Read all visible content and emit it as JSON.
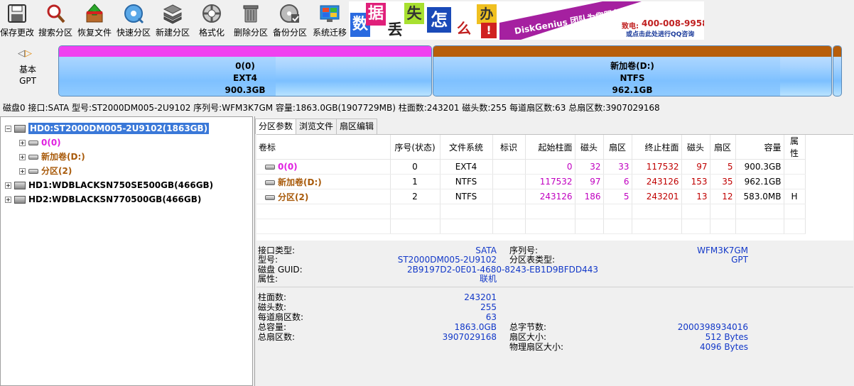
{
  "toolbar": {
    "buttons": [
      {
        "label": "保存更改",
        "icon": "save-icon"
      },
      {
        "label": "搜索分区",
        "icon": "search-icon"
      },
      {
        "label": "恢复文件",
        "icon": "recover-file-icon"
      },
      {
        "label": "快速分区",
        "icon": "quick-partition-icon"
      },
      {
        "label": "新建分区",
        "icon": "new-partition-icon"
      },
      {
        "label": "格式化",
        "icon": "format-icon"
      },
      {
        "label": "删除分区",
        "icon": "delete-partition-icon"
      },
      {
        "label": "备份分区",
        "icon": "backup-partition-icon"
      },
      {
        "label": "系统迁移",
        "icon": "system-migration-icon"
      }
    ]
  },
  "banner": {
    "chars": [
      "数",
      "据",
      "丢",
      "失",
      "怎",
      "么",
      "办",
      "!"
    ],
    "brand": "DiskGenius 团队为您服务",
    "phone_label": "致电:",
    "phone": "400-008-9958",
    "qq": "或点击此处进行QQ咨询"
  },
  "diskmap": {
    "disk_type_line1": "基本",
    "disk_type_line2": "GPT",
    "partitions": [
      {
        "name": "0(0)",
        "fs": "EXT4",
        "size": "900.3GB",
        "color": "#f040f0"
      },
      {
        "name": "新加卷(D:)",
        "fs": "NTFS",
        "size": "962.1GB",
        "color": "#b85e0a"
      }
    ]
  },
  "diskinfo": "磁盘0 接口:SATA  型号:ST2000DM005-2U9102  序列号:WFM3K7GM  容量:1863.0GB(1907729MB)  柱面数:243201  磁头数:255  每道扇区数:63  总扇区数:3907029168",
  "tree": {
    "disk0": "HD0:ST2000DM005-2U9102(1863GB)",
    "parts": [
      "0(0)",
      "新加卷(D:)",
      "分区(2)"
    ],
    "disk1": "HD1:WDBLACKSN750SE500GB(466GB)",
    "disk2": "HD2:WDBLACKSN770500GB(466GB)"
  },
  "tabs": [
    "分区参数",
    "浏览文件",
    "扇区编辑"
  ],
  "table": {
    "headers": [
      "卷标",
      "序号(状态)",
      "文件系统",
      "标识",
      "起始柱面",
      "磁头",
      "扇区",
      "终止柱面",
      "磁头",
      "扇区",
      "容量",
      "属性"
    ],
    "rows": [
      [
        "0(0)",
        "0",
        "EXT4",
        "",
        "0",
        "32",
        "33",
        "117532",
        "97",
        "5",
        "900.3GB",
        ""
      ],
      [
        "新加卷(D:)",
        "1",
        "NTFS",
        "",
        "117532",
        "97",
        "6",
        "243126",
        "153",
        "35",
        "962.1GB",
        ""
      ],
      [
        "分区(2)",
        "2",
        "NTFS",
        "",
        "243126",
        "186",
        "5",
        "243201",
        "13",
        "12",
        "583.0MB",
        "H"
      ]
    ]
  },
  "details": {
    "interface_label": "接口类型:",
    "interface": "SATA",
    "serial_label": "序列号:",
    "serial": "WFM3K7GM",
    "model_label": "型号:",
    "model": "ST2000DM005-2U9102",
    "ptable_label": "分区表类型:",
    "ptable": "GPT",
    "guid_label": "磁盘 GUID:",
    "guid": "2B9197D2-0E01-4680-8243-EB1D9BFDD443",
    "attr_label": "属性:",
    "attr": "联机",
    "cyl_label": "柱面数:",
    "cyl": "243201",
    "heads_label": "磁头数:",
    "heads": "255",
    "spt_label": "每道扇区数:",
    "spt": "63",
    "cap_label": "总容量:",
    "cap": "1863.0GB",
    "bytes_label": "总字节数:",
    "bytes": "2000398934016",
    "sectors_label": "总扇区数:",
    "sectors": "3907029168",
    "secsize_label": "扇区大小:",
    "secsize": "512 Bytes",
    "physsec_label": "物理扇区大小:",
    "physsec": "4096 Bytes"
  }
}
